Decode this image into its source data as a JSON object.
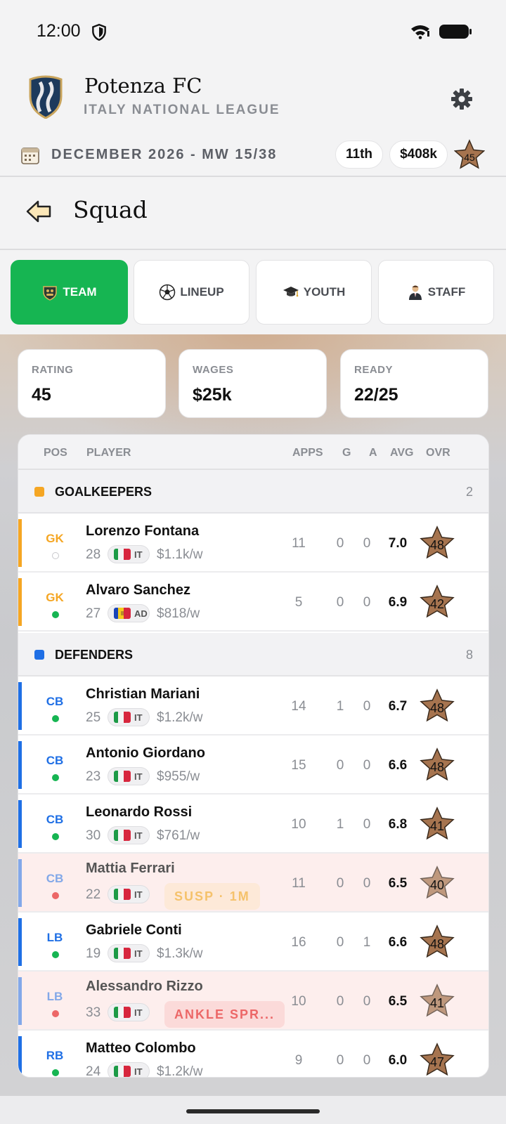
{
  "status": {
    "time": "12:00"
  },
  "header": {
    "club_name": "Potenza FC",
    "league": "ITALY NATIONAL LEAGUE"
  },
  "datebar": {
    "date": "DECEMBER 2026 - MW 15/38",
    "rank": "11th",
    "budget": "$408k",
    "rating": "45"
  },
  "page": {
    "title": "Squad"
  },
  "tabs": [
    {
      "label": "TEAM",
      "icon": "team-badge-icon",
      "active": true
    },
    {
      "label": "LINEUP",
      "icon": "football-icon",
      "active": false
    },
    {
      "label": "YOUTH",
      "icon": "graduation-cap-icon",
      "active": false
    },
    {
      "label": "STAFF",
      "icon": "manager-icon",
      "active": false
    }
  ],
  "stats": [
    {
      "label": "RATING",
      "value": "45"
    },
    {
      "label": "WAGES",
      "value": "$25k"
    },
    {
      "label": "READY",
      "value": "22/25"
    }
  ],
  "table": {
    "headers": {
      "pos": "POS",
      "player": "PLAYER",
      "apps": "APPS",
      "g": "G",
      "a": "A",
      "avg": "AVG",
      "ovr": "OVR"
    },
    "groups": [
      {
        "name": "GOALKEEPERS",
        "count": "2",
        "color": "#f5a623"
      },
      {
        "name": "DEFENDERS",
        "count": "8",
        "color": "#1f6fe5"
      }
    ],
    "rows": [
      {
        "pos": "GK",
        "pos_color": "#f5a623",
        "status": "none",
        "name": "Lorenzo Fontana",
        "age": "28",
        "nation": "IT",
        "wage": "$1.1k/w",
        "badge": "",
        "apps": "11",
        "g": "0",
        "a": "0",
        "avg": "7.0",
        "ovr": "48"
      },
      {
        "pos": "GK",
        "pos_color": "#f5a623",
        "status": "fit",
        "name": "Alvaro Sanchez",
        "age": "27",
        "nation": "AD",
        "wage": "$818/w",
        "badge": "",
        "apps": "5",
        "g": "0",
        "a": "0",
        "avg": "6.9",
        "ovr": "42"
      },
      {
        "pos": "CB",
        "pos_color": "#1f6fe5",
        "status": "fit",
        "name": "Christian Mariani",
        "age": "25",
        "nation": "IT",
        "wage": "$1.2k/w",
        "badge": "",
        "apps": "14",
        "g": "1",
        "a": "0",
        "avg": "6.7",
        "ovr": "48"
      },
      {
        "pos": "CB",
        "pos_color": "#1f6fe5",
        "status": "fit",
        "name": "Antonio Giordano",
        "age": "23",
        "nation": "IT",
        "wage": "$955/w",
        "badge": "",
        "apps": "15",
        "g": "0",
        "a": "0",
        "avg": "6.6",
        "ovr": "48"
      },
      {
        "pos": "CB",
        "pos_color": "#1f6fe5",
        "status": "fit",
        "name": "Leonardo Rossi",
        "age": "30",
        "nation": "IT",
        "wage": "$761/w",
        "badge": "",
        "apps": "10",
        "g": "1",
        "a": "0",
        "avg": "6.8",
        "ovr": "41"
      },
      {
        "pos": "CB",
        "pos_color": "#1f6fe5",
        "status": "out",
        "name": "Mattia Ferrari",
        "age": "22",
        "nation": "IT",
        "wage": "",
        "badge": "SUSP · 1M",
        "apps": "11",
        "g": "0",
        "a": "0",
        "avg": "6.5",
        "ovr": "40"
      },
      {
        "pos": "LB",
        "pos_color": "#1f6fe5",
        "status": "fit",
        "name": "Gabriele Conti",
        "age": "19",
        "nation": "IT",
        "wage": "$1.3k/w",
        "badge": "",
        "apps": "16",
        "g": "0",
        "a": "1",
        "avg": "6.6",
        "ovr": "48"
      },
      {
        "pos": "LB",
        "pos_color": "#1f6fe5",
        "status": "out",
        "name": "Alessandro Rizzo",
        "age": "33",
        "nation": "IT",
        "wage": "",
        "badge": "ANKLE SPR...",
        "apps": "10",
        "g": "0",
        "a": "0",
        "avg": "6.5",
        "ovr": "41"
      },
      {
        "pos": "RB",
        "pos_color": "#1f6fe5",
        "status": "fit",
        "name": "Matteo Colombo",
        "age": "24",
        "nation": "IT",
        "wage": "$1.2k/w",
        "badge": "",
        "apps": "9",
        "g": "0",
        "a": "0",
        "avg": "6.0",
        "ovr": "47"
      }
    ]
  },
  "colors": {
    "accent": "#16b552",
    "star_fill": "#a6744f",
    "fit": "#16b552",
    "out": "#ec6767"
  }
}
